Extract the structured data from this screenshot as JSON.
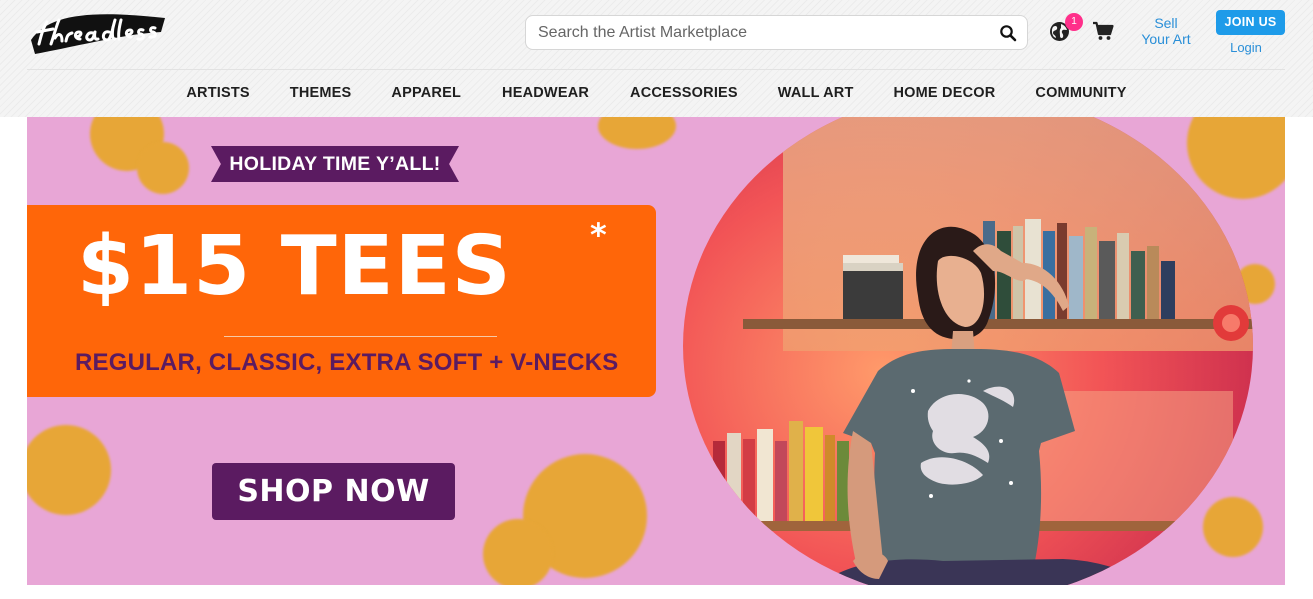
{
  "header": {
    "search_placeholder": "Search the Artist Marketplace",
    "region_badge": "1",
    "sell_line1": "Sell",
    "sell_line2": "Your Art",
    "join_label": "JOIN US",
    "login_label": "Login"
  },
  "nav": [
    "ARTISTS",
    "THEMES",
    "APPAREL",
    "HEADWEAR",
    "ACCESSORIES",
    "WALL ART",
    "HOME DECOR",
    "COMMUNITY"
  ],
  "hero": {
    "tag": "HOLIDAY TIME Y’ALL!",
    "headline": "$15 TEES",
    "asterisk": "*",
    "subhead": "REGULAR, CLASSIC, EXTRA SOFT + V-NECKS",
    "cta": "SHOP NOW"
  },
  "colors": {
    "brand_blue": "#1e9be9",
    "link_blue": "#2a8fd8",
    "hero_pink": "#e8a6d6",
    "promo_orange": "#ff6609",
    "purple": "#5b1b61",
    "dot_gold": "#e7a637",
    "badge_pink": "#ff2f8a"
  },
  "icons": [
    "threadless-logo",
    "search-icon",
    "globe-icon",
    "cart-icon"
  ]
}
